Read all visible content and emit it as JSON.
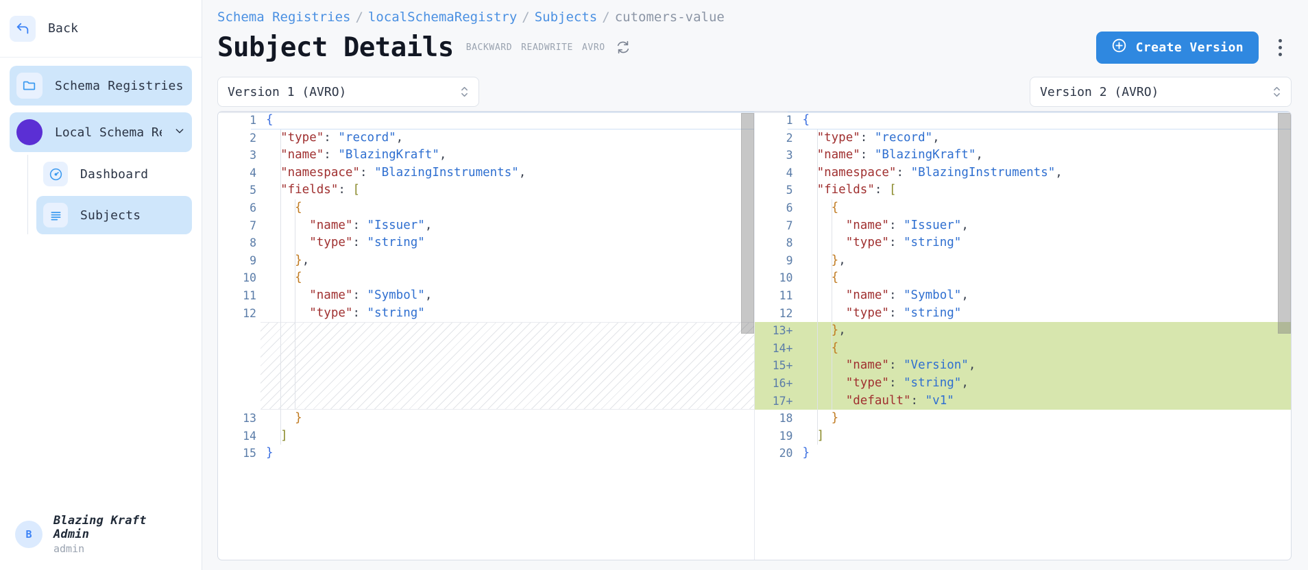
{
  "sidebar": {
    "back_label": "Back",
    "back_icon": "arrow-left-icon",
    "registries_label": "Schema Registries",
    "registries_icon": "folder-icon",
    "registry_name": "Local Schema Regi…",
    "registry_chevron": "chevron-down-icon",
    "subitems": [
      {
        "label": "Dashboard",
        "icon": "gauge-icon",
        "selected": false
      },
      {
        "label": "Subjects",
        "icon": "list-icon",
        "selected": true
      }
    ],
    "user": {
      "avatar_initial": "B",
      "name": "Blazing Kraft Admin",
      "role": "admin"
    }
  },
  "header": {
    "breadcrumb": [
      {
        "label": "Schema Registries",
        "link": true
      },
      {
        "label": "localSchemaRegistry",
        "link": true
      },
      {
        "label": "Subjects",
        "link": true
      },
      {
        "label": "cutomers-value",
        "link": false
      }
    ],
    "separator": "/",
    "title": "Subject Details",
    "badges": [
      "BACKWARD",
      "READWRITE",
      "AVRO"
    ],
    "refresh_icon": "refresh-icon",
    "create_button": {
      "label": "Create Version",
      "icon": "plus-circle-icon"
    },
    "overflow_menu_icon": "kebab-menu-icon"
  },
  "selectors": {
    "left": "Version 1 (AVRO)",
    "right": "Version 2 (AVRO)",
    "stepper_icon": "up-down-chevron-icon"
  },
  "colors": {
    "accent": "#2f88e0",
    "link": "#4a90e2",
    "added_line": "#d7e6ae",
    "registry_dot": "#5b2fd4",
    "sidebar_selected": "#cfe6fb"
  },
  "diff": {
    "left": {
      "lines": [
        {
          "n": "1",
          "tokens": [
            {
              "t": "{",
              "c": "br1"
            }
          ]
        },
        {
          "n": "2",
          "tokens": [
            {
              "t": "  ",
              "c": "p"
            },
            {
              "t": "\"type\"",
              "c": "key"
            },
            {
              "t": ": ",
              "c": "p"
            },
            {
              "t": "\"record\"",
              "c": "str"
            },
            {
              "t": ",",
              "c": "p"
            }
          ]
        },
        {
          "n": "3",
          "tokens": [
            {
              "t": "  ",
              "c": "p"
            },
            {
              "t": "\"name\"",
              "c": "key"
            },
            {
              "t": ": ",
              "c": "p"
            },
            {
              "t": "\"BlazingKraft\"",
              "c": "str"
            },
            {
              "t": ",",
              "c": "p"
            }
          ]
        },
        {
          "n": "4",
          "tokens": [
            {
              "t": "  ",
              "c": "p"
            },
            {
              "t": "\"namespace\"",
              "c": "key"
            },
            {
              "t": ": ",
              "c": "p"
            },
            {
              "t": "\"BlazingInstruments\"",
              "c": "str"
            },
            {
              "t": ",",
              "c": "p"
            }
          ]
        },
        {
          "n": "5",
          "tokens": [
            {
              "t": "  ",
              "c": "p"
            },
            {
              "t": "\"fields\"",
              "c": "key"
            },
            {
              "t": ": ",
              "c": "p"
            },
            {
              "t": "[",
              "c": "br2"
            }
          ]
        },
        {
          "n": "6",
          "tokens": [
            {
              "t": "    ",
              "c": "p"
            },
            {
              "t": "{",
              "c": "br3"
            }
          ]
        },
        {
          "n": "7",
          "tokens": [
            {
              "t": "      ",
              "c": "p"
            },
            {
              "t": "\"name\"",
              "c": "key"
            },
            {
              "t": ": ",
              "c": "p"
            },
            {
              "t": "\"Issuer\"",
              "c": "str"
            },
            {
              "t": ",",
              "c": "p"
            }
          ]
        },
        {
          "n": "8",
          "tokens": [
            {
              "t": "      ",
              "c": "p"
            },
            {
              "t": "\"type\"",
              "c": "key"
            },
            {
              "t": ": ",
              "c": "p"
            },
            {
              "t": "\"string\"",
              "c": "str"
            }
          ]
        },
        {
          "n": "9",
          "tokens": [
            {
              "t": "    ",
              "c": "p"
            },
            {
              "t": "}",
              "c": "br3"
            },
            {
              "t": ",",
              "c": "p"
            }
          ]
        },
        {
          "n": "10",
          "tokens": [
            {
              "t": "    ",
              "c": "p"
            },
            {
              "t": "{",
              "c": "br3"
            }
          ]
        },
        {
          "n": "11",
          "tokens": [
            {
              "t": "      ",
              "c": "p"
            },
            {
              "t": "\"name\"",
              "c": "key"
            },
            {
              "t": ": ",
              "c": "p"
            },
            {
              "t": "\"Symbol\"",
              "c": "str"
            },
            {
              "t": ",",
              "c": "p"
            }
          ]
        },
        {
          "n": "12",
          "tokens": [
            {
              "t": "      ",
              "c": "p"
            },
            {
              "t": "\"type\"",
              "c": "key"
            },
            {
              "t": ": ",
              "c": "p"
            },
            {
              "t": "\"string\"",
              "c": "str"
            }
          ]
        },
        {
          "n": "",
          "gap": true
        },
        {
          "n": "",
          "gap": true
        },
        {
          "n": "",
          "gap": true
        },
        {
          "n": "",
          "gap": true
        },
        {
          "n": "",
          "gap": true
        },
        {
          "n": "13",
          "tokens": [
            {
              "t": "    ",
              "c": "p"
            },
            {
              "t": "}",
              "c": "br3"
            }
          ]
        },
        {
          "n": "14",
          "tokens": [
            {
              "t": "  ",
              "c": "p"
            },
            {
              "t": "]",
              "c": "br2"
            }
          ]
        },
        {
          "n": "15",
          "tokens": [
            {
              "t": "}",
              "c": "br1"
            }
          ]
        }
      ]
    },
    "right": {
      "lines": [
        {
          "n": "1",
          "tokens": [
            {
              "t": "{",
              "c": "br1"
            }
          ]
        },
        {
          "n": "2",
          "tokens": [
            {
              "t": "  ",
              "c": "p"
            },
            {
              "t": "\"type\"",
              "c": "key"
            },
            {
              "t": ": ",
              "c": "p"
            },
            {
              "t": "\"record\"",
              "c": "str"
            },
            {
              "t": ",",
              "c": "p"
            }
          ]
        },
        {
          "n": "3",
          "tokens": [
            {
              "t": "  ",
              "c": "p"
            },
            {
              "t": "\"name\"",
              "c": "key"
            },
            {
              "t": ": ",
              "c": "p"
            },
            {
              "t": "\"BlazingKraft\"",
              "c": "str"
            },
            {
              "t": ",",
              "c": "p"
            }
          ]
        },
        {
          "n": "4",
          "tokens": [
            {
              "t": "  ",
              "c": "p"
            },
            {
              "t": "\"namespace\"",
              "c": "key"
            },
            {
              "t": ": ",
              "c": "p"
            },
            {
              "t": "\"BlazingInstruments\"",
              "c": "str"
            },
            {
              "t": ",",
              "c": "p"
            }
          ]
        },
        {
          "n": "5",
          "tokens": [
            {
              "t": "  ",
              "c": "p"
            },
            {
              "t": "\"fields\"",
              "c": "key"
            },
            {
              "t": ": ",
              "c": "p"
            },
            {
              "t": "[",
              "c": "br2"
            }
          ]
        },
        {
          "n": "6",
          "tokens": [
            {
              "t": "    ",
              "c": "p"
            },
            {
              "t": "{",
              "c": "br3"
            }
          ]
        },
        {
          "n": "7",
          "tokens": [
            {
              "t": "      ",
              "c": "p"
            },
            {
              "t": "\"name\"",
              "c": "key"
            },
            {
              "t": ": ",
              "c": "p"
            },
            {
              "t": "\"Issuer\"",
              "c": "str"
            },
            {
              "t": ",",
              "c": "p"
            }
          ]
        },
        {
          "n": "8",
          "tokens": [
            {
              "t": "      ",
              "c": "p"
            },
            {
              "t": "\"type\"",
              "c": "key"
            },
            {
              "t": ": ",
              "c": "p"
            },
            {
              "t": "\"string\"",
              "c": "str"
            }
          ]
        },
        {
          "n": "9",
          "tokens": [
            {
              "t": "    ",
              "c": "p"
            },
            {
              "t": "}",
              "c": "br3"
            },
            {
              "t": ",",
              "c": "p"
            }
          ]
        },
        {
          "n": "10",
          "tokens": [
            {
              "t": "    ",
              "c": "p"
            },
            {
              "t": "{",
              "c": "br3"
            }
          ]
        },
        {
          "n": "11",
          "tokens": [
            {
              "t": "      ",
              "c": "p"
            },
            {
              "t": "\"name\"",
              "c": "key"
            },
            {
              "t": ": ",
              "c": "p"
            },
            {
              "t": "\"Symbol\"",
              "c": "str"
            },
            {
              "t": ",",
              "c": "p"
            }
          ]
        },
        {
          "n": "12",
          "tokens": [
            {
              "t": "      ",
              "c": "p"
            },
            {
              "t": "\"type\"",
              "c": "key"
            },
            {
              "t": ": ",
              "c": "p"
            },
            {
              "t": "\"string\"",
              "c": "str"
            }
          ]
        },
        {
          "n": "13",
          "added": true,
          "tokens": [
            {
              "t": "    ",
              "c": "p"
            },
            {
              "t": "}",
              "c": "br3"
            },
            {
              "t": ",",
              "c": "p"
            }
          ]
        },
        {
          "n": "14",
          "added": true,
          "tokens": [
            {
              "t": "    ",
              "c": "p"
            },
            {
              "t": "{",
              "c": "br3"
            }
          ]
        },
        {
          "n": "15",
          "added": true,
          "tokens": [
            {
              "t": "      ",
              "c": "p"
            },
            {
              "t": "\"name\"",
              "c": "key"
            },
            {
              "t": ": ",
              "c": "p"
            },
            {
              "t": "\"Version\"",
              "c": "str"
            },
            {
              "t": ",",
              "c": "p"
            }
          ]
        },
        {
          "n": "16",
          "added": true,
          "tokens": [
            {
              "t": "      ",
              "c": "p"
            },
            {
              "t": "\"type\"",
              "c": "key"
            },
            {
              "t": ": ",
              "c": "p"
            },
            {
              "t": "\"string\"",
              "c": "str"
            },
            {
              "t": ",",
              "c": "p"
            }
          ]
        },
        {
          "n": "17",
          "added": true,
          "tokens": [
            {
              "t": "      ",
              "c": "p"
            },
            {
              "t": "\"default\"",
              "c": "key"
            },
            {
              "t": ": ",
              "c": "p"
            },
            {
              "t": "\"v1\"",
              "c": "str"
            }
          ]
        },
        {
          "n": "18",
          "tokens": [
            {
              "t": "    ",
              "c": "p"
            },
            {
              "t": "}",
              "c": "br3"
            }
          ]
        },
        {
          "n": "19",
          "tokens": [
            {
              "t": "  ",
              "c": "p"
            },
            {
              "t": "]",
              "c": "br2"
            }
          ]
        },
        {
          "n": "20",
          "tokens": [
            {
              "t": "}",
              "c": "br1"
            }
          ]
        }
      ]
    }
  }
}
